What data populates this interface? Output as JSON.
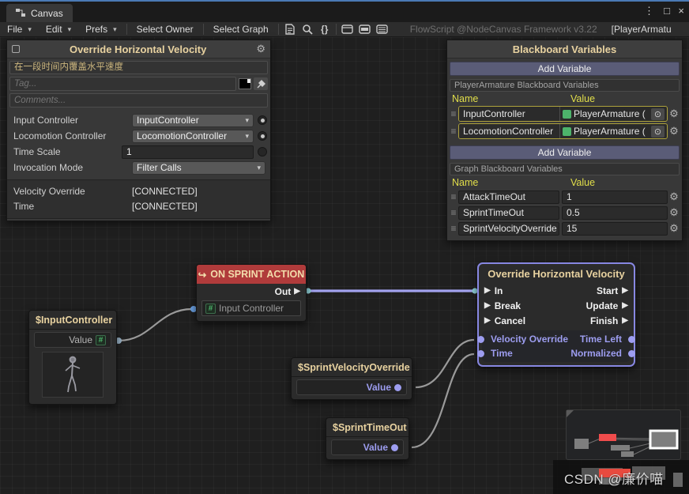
{
  "colors": {
    "accent_blue": "#4a7ab5",
    "event_red": "#b03b3b",
    "node_title_cream": "#e8d2a0",
    "blackboard_header_yellow": "#e2df4a",
    "row_outline_olive": "#ada23c",
    "port_lavender": "#9d9df0",
    "wire_lavender": "#a3a3ef",
    "wire_gray": "#9a9a9a",
    "add_button_slate": "#5a5c77",
    "object_icon_green": "#4db36b"
  },
  "icons": {
    "gear": "⚙",
    "dropdown_arrow": "▾",
    "menu_arrow": "▾",
    "flow_port": "▶",
    "drag_handle": "≡",
    "object_picker": "⊙",
    "braces": "{}",
    "more": "⋮",
    "maximize": "□",
    "close": "×",
    "event_arrow": "↪",
    "hash": "#"
  },
  "window": {
    "tab_label": "Canvas",
    "menus": [
      {
        "label": "File"
      },
      {
        "label": "Edit"
      },
      {
        "label": "Prefs"
      }
    ],
    "actions": [
      {
        "label": "Select Owner"
      },
      {
        "label": "Select Graph"
      }
    ],
    "framework_label": "FlowScript @NodeCanvas Framework v3.22",
    "owner_label": "[PlayerArmatu"
  },
  "inspector": {
    "title": "Override Horizontal Velocity",
    "description": "在一段时间内覆盖水平速度",
    "tag_placeholder": "Tag...",
    "comments_placeholder": "Comments...",
    "fields": [
      {
        "label": "Input Controller",
        "value": "InputController"
      },
      {
        "label": "Locomotion Controller",
        "value": "LocomotionController"
      },
      {
        "label": "Time Scale",
        "value": "1"
      },
      {
        "label": "Invocation Mode",
        "value": "Filter Calls"
      }
    ],
    "connected": [
      {
        "label": "Velocity Override",
        "value": "[CONNECTED]"
      },
      {
        "label": "Time",
        "value": "[CONNECTED]"
      }
    ]
  },
  "blackboard": {
    "title": "Blackboard Variables",
    "add_button": "Add Variable",
    "sections": [
      {
        "caption": "PlayerArmature Blackboard Variables",
        "name_header": "Name",
        "value_header": "Value",
        "rows": [
          {
            "name": "InputController",
            "value": "PlayerArmature ("
          },
          {
            "name": "LocomotionController",
            "value": "PlayerArmature ("
          }
        ]
      },
      {
        "caption": "Graph Blackboard Variables",
        "name_header": "Name",
        "value_header": "Value",
        "rows": [
          {
            "name": "AttackTimeOut",
            "value": "1"
          },
          {
            "name": "SprintTimeOut",
            "value": "0.5"
          },
          {
            "name": "SprintVelocityOverride",
            "value": "15"
          }
        ]
      }
    ]
  },
  "graph": {
    "sprint_event": {
      "title": "ON SPRINT ACTION",
      "out_label": "Out",
      "param_label": "Input Controller"
    },
    "input_var": {
      "title": "$InputController",
      "value_label": "Value"
    },
    "override": {
      "title": "Override Horizontal Velocity",
      "flow_in": [
        "In",
        "Break",
        "Cancel"
      ],
      "flow_out": [
        "Start",
        "Update",
        "Finish"
      ],
      "value_in": [
        "Velocity Override",
        "Time"
      ],
      "value_out": [
        "Time Left",
        "Normalized"
      ]
    },
    "sprint_velocity_var": {
      "title": "$SprintVelocityOverride",
      "value_label": "Value"
    },
    "sprint_timeout_var": {
      "title": "$SprintTimeOut",
      "value_label": "Value"
    }
  },
  "watermark": "CSDN @廉价喵"
}
